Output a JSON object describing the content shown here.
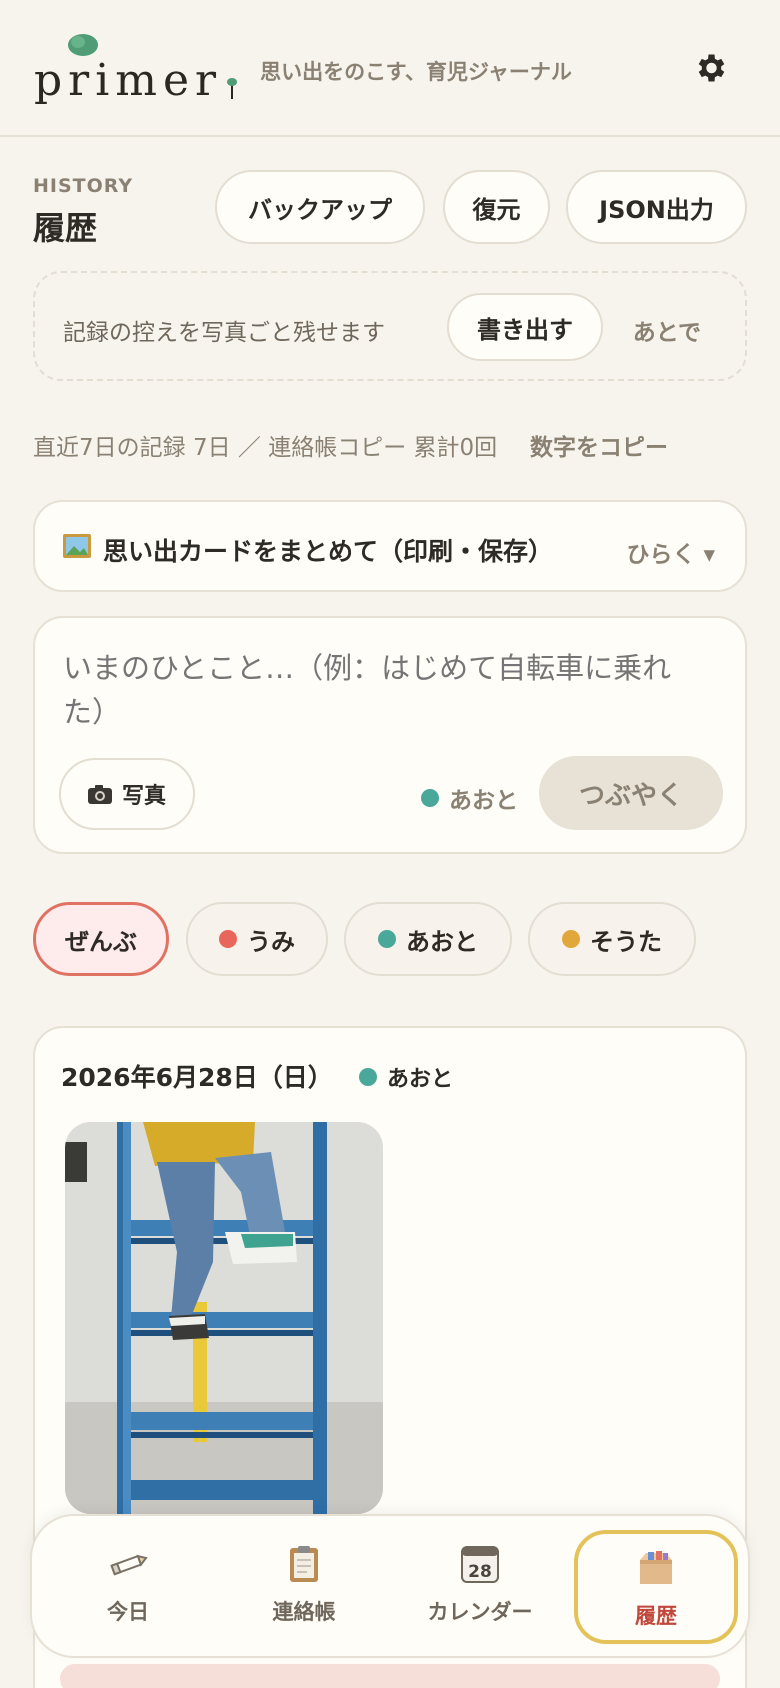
{
  "header": {
    "logo_text": "primer",
    "tagline": "思い出をのこす、育児ジャーナル",
    "settings_icon": "gear-icon"
  },
  "history": {
    "label_en": "HISTORY",
    "title": "履歴",
    "buttons": {
      "backup": "バックアップ",
      "restore": "復元",
      "json_export": "JSON出力"
    }
  },
  "notice": {
    "text": "記録の控えを写真ごと残せます",
    "export_button": "書き出す",
    "later": "あとで"
  },
  "stats": {
    "text": "直近7日の記録 7日 ／ 連絡帳コピー 累計0回",
    "copy_button": "数字をコピー"
  },
  "memory_card": {
    "icon": "picture-frame-icon",
    "title": "思い出カードをまとめて（印刷・保存）",
    "toggle": "ひらく ▾"
  },
  "composer": {
    "placeholder": "いまのひとこと…（例：はじめて自転車に乗れた）",
    "photo_button": "写真",
    "photo_icon": "camera-icon",
    "selected_child": "あおと",
    "submit": "つぶやく"
  },
  "filters": [
    {
      "label": "ぜんぶ",
      "color": ""
    },
    {
      "label": "うみ",
      "color": "#e8665a"
    },
    {
      "label": "あおと",
      "color": "#4aa89a"
    },
    {
      "label": "そうた",
      "color": "#e2a73a"
    }
  ],
  "entry": {
    "date": "2026年6月28日（日）",
    "child": "あおと",
    "child_color": "#4aa89a"
  },
  "tabs": [
    {
      "label": "今日",
      "icon": "pencil-icon"
    },
    {
      "label": "連絡帳",
      "icon": "clipboard-icon"
    },
    {
      "label": "カレンダー",
      "icon": "calendar-icon",
      "calendar_day": "28"
    },
    {
      "label": "履歴",
      "icon": "archive-box-icon"
    }
  ],
  "colors": {
    "background": "#f7f4ee",
    "accent_red": "#e07263",
    "accent_yellow": "#e4c25a",
    "teal": "#4aa89a"
  }
}
